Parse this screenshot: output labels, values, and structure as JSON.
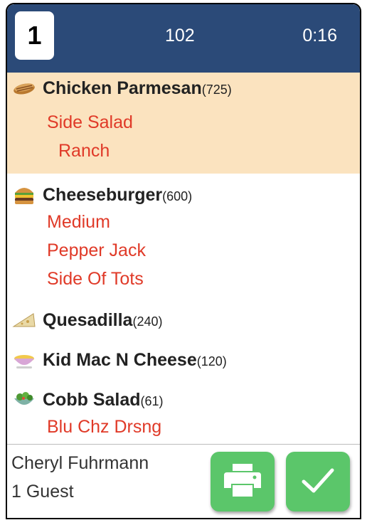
{
  "header": {
    "seat": "1",
    "order_number": "102",
    "elapsed": "0:16"
  },
  "items": [
    {
      "icon": "sandwich-icon",
      "name": "Chicken Parmesan",
      "count": "(725)",
      "modifiers": [
        "Side Salad",
        "Ranch"
      ],
      "highlighted": true
    },
    {
      "icon": "burger-icon",
      "name": "Cheeseburger",
      "count": "(600)",
      "modifiers": [
        "Medium",
        "Pepper Jack",
        "Side Of Tots"
      ],
      "highlighted": false
    },
    {
      "icon": "quesadilla-icon",
      "name": "Quesadilla",
      "count": "(240)",
      "modifiers": [],
      "highlighted": false
    },
    {
      "icon": "mac-n-cheese-icon",
      "name": "Kid Mac N Cheese",
      "count": "(120)",
      "modifiers": [],
      "highlighted": false
    },
    {
      "icon": "salad-icon",
      "name": "Cobb Salad",
      "count": "(61)",
      "modifiers": [
        "Blu Chz Drsng"
      ],
      "highlighted": false
    }
  ],
  "footer": {
    "server": "Cheryl Fuhrmann",
    "guests": "1 Guest"
  },
  "colors": {
    "header": "#2b4a78",
    "highlight": "#fbe3bf",
    "modifier": "#e03a28",
    "button": "#5bc66a"
  }
}
